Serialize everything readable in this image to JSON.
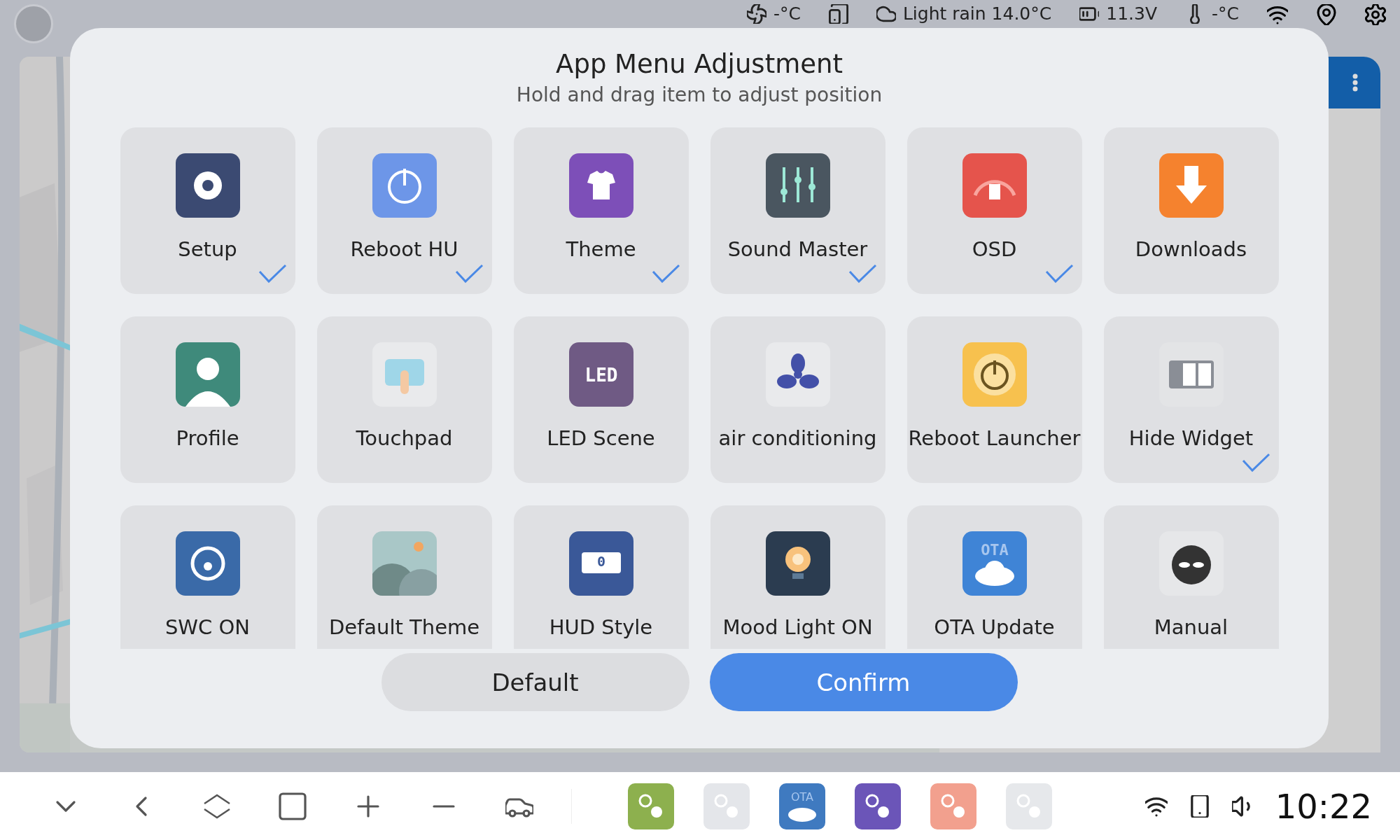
{
  "status_bar": {
    "items": [
      {
        "kind": "fan",
        "text": "-°C"
      },
      {
        "kind": "phone"
      },
      {
        "kind": "cloud",
        "text": "Light rain 14.0°C"
      },
      {
        "kind": "battery",
        "text": "11.3V"
      },
      {
        "kind": "thermo",
        "text": "-°C"
      }
    ]
  },
  "dialog": {
    "title": "App Menu Adjustment",
    "subtitle": "Hold and drag item to adjust position",
    "items": [
      {
        "label": "Setup",
        "checked": true
      },
      {
        "label": "Reboot HU",
        "checked": true
      },
      {
        "label": "Theme",
        "checked": true
      },
      {
        "label": "Sound Master",
        "checked": true
      },
      {
        "label": "OSD",
        "checked": true
      },
      {
        "label": "Downloads",
        "checked": false
      },
      {
        "label": "Profile",
        "checked": false
      },
      {
        "label": "Touchpad",
        "checked": false
      },
      {
        "label": "LED Scene",
        "checked": false,
        "icon_text": "LED"
      },
      {
        "label": "air conditioning",
        "checked": false
      },
      {
        "label": "Reboot Launcher",
        "checked": false
      },
      {
        "label": "Hide Widget",
        "checked": true
      },
      {
        "label": "SWC ON",
        "checked": false
      },
      {
        "label": "Default Theme",
        "checked": false
      },
      {
        "label": "HUD Style",
        "checked": false,
        "icon_text": "0"
      },
      {
        "label": "Mood Light ON",
        "checked": false
      },
      {
        "label": "OTA Update",
        "checked": false,
        "icon_text": "OTA"
      },
      {
        "label": "Manual",
        "checked": false
      }
    ],
    "buttons": [
      {
        "label": "Default",
        "kind": "secondary"
      },
      {
        "label": "Confirm",
        "kind": "primary"
      }
    ]
  },
  "taskbar": {
    "apps": [
      {
        "color": "#8db04e"
      },
      {
        "color": "#e4e6ea"
      },
      {
        "color": "#3f7ac0",
        "icon_text": "OTA"
      },
      {
        "color": "#6b55b8"
      },
      {
        "color": "#f2a08e"
      },
      {
        "color": "#e6e8eb"
      }
    ],
    "clock": "10:22"
  }
}
